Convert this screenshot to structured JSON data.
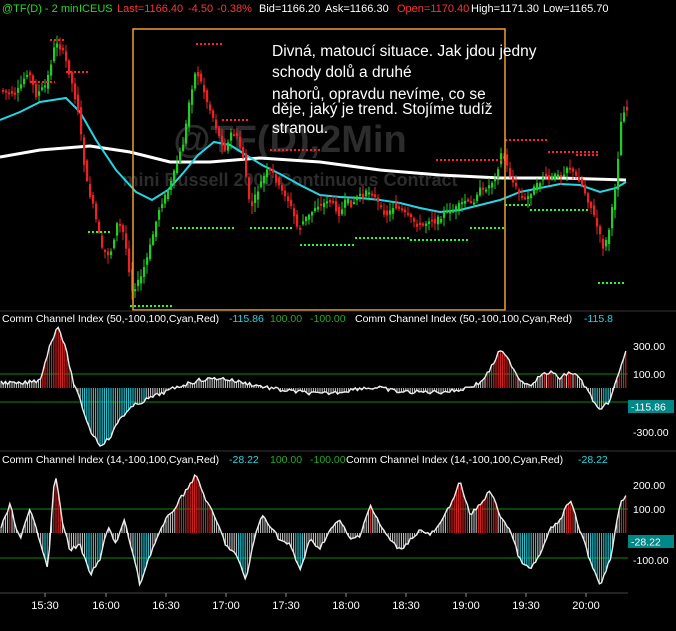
{
  "header": {
    "symbol": "@TF(D) - 2 min",
    "exchange": "ICEUS",
    "last_label": "Last=1166.40",
    "change": "-4.50",
    "change_pct": "-0.38%",
    "bid_label": "Bid=1166.20",
    "ask_label": "Ask=1166.30",
    "open_label": "Open=1170.40",
    "high_label": "High=1171.30",
    "low_label": "Low=1165.70"
  },
  "watermark": {
    "main": "@TF(D),2Min",
    "sub": "mini Russell 2000 Continuous Contract"
  },
  "annotation": "Divná, matoucí situace. Jak jdou jedny schody dolů a druhé nahorů, opravdu nevíme, co se děje, jaký je trend. Stojíme tudíž stranou.",
  "cci50": {
    "label": "Comm Channel Index (50,-100,100,Cyan,Red)",
    "value": "-115.86",
    "level_high": "100.00",
    "level_low": "-100.00",
    "label_repeat": "Comm Channel Index (50,-100,100,Cyan,Red)",
    "value_repeat": "-115.8",
    "ticks": [
      "300.00",
      "100.00",
      "-300.00"
    ],
    "tag": "-115.86"
  },
  "cci14": {
    "label": "Comm Channel Index (14,-100,100,Cyan,Red)",
    "value": "-28.22",
    "level_high": "100.00",
    "level_low": "-100.00",
    "label_repeat": "Comm Channel Index (14,-100,100,Cyan,Red)",
    "value_repeat": "-28.22",
    "ticks": [
      "200.00",
      "100.00",
      "-100.00"
    ],
    "tag": "-28.22"
  },
  "time_axis": [
    "15:30",
    "16:00",
    "16:30",
    "17:00",
    "17:30",
    "18:00",
    "18:30",
    "19:00",
    "19:30",
    "20:00"
  ],
  "colors": {
    "up": "#22cc22",
    "down": "#ee2222",
    "ma_fast": "#22d8e6",
    "ma_slow": "#ffffff",
    "box": "#f0a030",
    "resistance": "#ff2222",
    "support": "#22ff22",
    "header_symbol": "#22dd22",
    "header_red": "#ff3333",
    "header_white": "#ffffff",
    "tag_fill": "#008888"
  },
  "chart_data": {
    "type": "line",
    "x": [
      "15:30",
      "16:00",
      "16:30",
      "17:00",
      "17:30",
      "18:00",
      "18:30",
      "19:00",
      "19:30",
      "20:00"
    ],
    "series": [],
    "indicators": [
      {
        "name": "Comm Channel Index (50,-100,100,Cyan,Red)",
        "last": -115.86,
        "levels": [
          100,
          -100
        ],
        "ticks": [
          300,
          100,
          -300
        ]
      },
      {
        "name": "Comm Channel Index (14,-100,100,Cyan,Red)",
        "last": -28.22,
        "levels": [
          100,
          -100
        ],
        "ticks": [
          200,
          100,
          -100
        ]
      }
    ],
    "grid": false
  }
}
